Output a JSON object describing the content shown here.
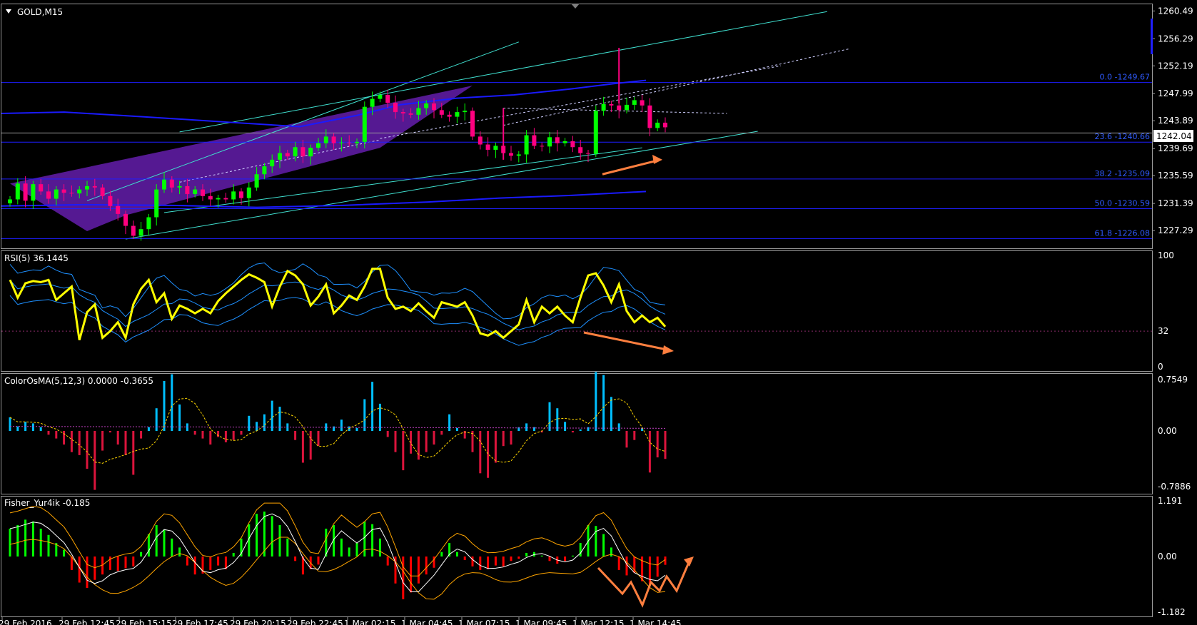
{
  "window": {
    "symbol_label": "GOLD,M15",
    "current_price": "1242.04"
  },
  "price_axis": {
    "ticks": [
      "1260.49",
      "1256.29",
      "1252.19",
      "1247.99",
      "1243.89",
      "1239.69",
      "1235.59",
      "1231.39",
      "1227.29"
    ]
  },
  "fib_levels": [
    {
      "label": "0.0 -1249.67",
      "value": 1249.67
    },
    {
      "label": "23.6 -1240.66",
      "value": 1240.66
    },
    {
      "label": "38.2 -1235.09",
      "value": 1235.09
    },
    {
      "label": "50.0 -1230.59",
      "value": 1230.59
    },
    {
      "label": "61.8 -1226.08",
      "value": 1226.08
    }
  ],
  "rsi_panel": {
    "label": "RSI(5) 36.1445",
    "ticks": [
      "100",
      "32",
      "0"
    ],
    "level": 32
  },
  "osma_panel": {
    "label": "ColorOsMA(5,12,3) 0.0000 -0.3655",
    "ticks": [
      "0.7549",
      "0.00",
      "-0.7886"
    ]
  },
  "fisher_panel": {
    "label": "Fisher_Yur4ik -0.185",
    "ticks": [
      "1.191",
      "0.00",
      "-1.182"
    ]
  },
  "time_axis": {
    "ticks": [
      "29 Feb 2016",
      "29 Feb 12:45",
      "29 Feb 15:15",
      "29 Feb 17:45",
      "29 Feb 20:15",
      "29 Feb 22:45",
      "1 Mar 02:15",
      "1 Mar 04:45",
      "1 Mar 07:15",
      "1 Mar 09:45",
      "1 Mar 12:15",
      "1 Mar 14:45"
    ]
  },
  "colors": {
    "background": "#000000",
    "bull_candle": "#00ff00",
    "bear_candle": "#ff0080",
    "rsi_line": "#ffff00",
    "band_line": "#1e90ff",
    "osma_up": "#00bfff",
    "osma_down": "#dc143c",
    "fisher_up": "#00ff00",
    "fisher_down": "#ff0000",
    "fisher_band": "#ffa500",
    "fib_line": "#1e1eff",
    "channel_line": "#40e0d0",
    "arrow": "#ff7f3f",
    "channel_fill": "#5a1a9a"
  },
  "chart_data": [
    {
      "type": "candlestick",
      "title": "GOLD,M15",
      "ylim": [
        1224.5,
        1261.5
      ],
      "x": [
        "29 Feb 2016",
        "29 Feb 12:45",
        "29 Feb 15:15",
        "29 Feb 17:45",
        "29 Feb 20:15",
        "29 Feb 22:45",
        "1 Mar 02:15",
        "1 Mar 04:45",
        "1 Mar 07:15",
        "1 Mar 09:45",
        "1 Mar 12:15",
        "1 Mar 14:45"
      ],
      "close": [
        1232.0,
        1234.4,
        1231.8,
        1234.3,
        1233.2,
        1232.1,
        1233.5,
        1233.0,
        1232.9,
        1233.5,
        1234.0,
        1233.8,
        1232.5,
        1231.0,
        1229.8,
        1228.0,
        1226.5,
        1227.5,
        1229.3,
        1233.5,
        1235.0,
        1233.8,
        1234.0,
        1232.8,
        1233.5,
        1232.5,
        1232.0,
        1232.2,
        1232.0,
        1233.2,
        1232.2,
        1233.8,
        1235.8,
        1237.0,
        1238.0,
        1239.0,
        1238.5,
        1239.9,
        1238.5,
        1239.8,
        1240.5,
        1241.5,
        1240.5,
        1240.6,
        1240.5,
        1240.7,
        1246.0,
        1247.2,
        1247.8,
        1246.6,
        1245.2,
        1245.0,
        1244.8,
        1245.8,
        1246.5,
        1245.5,
        1244.8,
        1244.5,
        1245.2,
        1245.4,
        1241.5,
        1240.3,
        1239.5,
        1240.1,
        1239.0,
        1238.6,
        1238.8,
        1241.7,
        1240.1,
        1240.0,
        1241.4,
        1240.5,
        1240.8,
        1239.9,
        1239.0,
        1238.9,
        1245.4,
        1246.4,
        1246.2,
        1245.5,
        1246.3,
        1247.0,
        1246.2,
        1242.8,
        1243.6,
        1242.9
      ],
      "ohlc_note": "open/high/low approximate",
      "series": [
        {
          "name": "RSI(5)",
          "last": 36.1445
        },
        {
          "name": "ColorOsMA(5,12,3)",
          "last": -0.3655
        },
        {
          "name": "Fisher_Yur4ik",
          "last": -0.185
        }
      ]
    }
  ]
}
